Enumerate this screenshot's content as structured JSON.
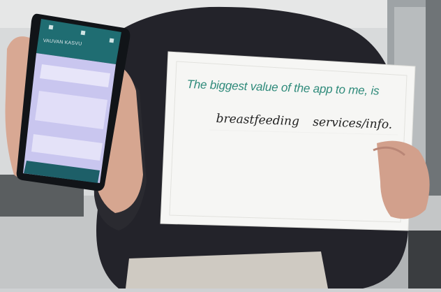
{
  "sign": {
    "header": "The biggest value of the app to me, is",
    "answer": "breastfeeding services/info."
  },
  "phone": {
    "app_title": "VAUVAN KASVU"
  },
  "colors": {
    "sign_header_text": "#2e8a7a",
    "phone_header": "#1f6d72",
    "phone_screen_body": "#c9c6ef",
    "shirt": "#23232a"
  }
}
